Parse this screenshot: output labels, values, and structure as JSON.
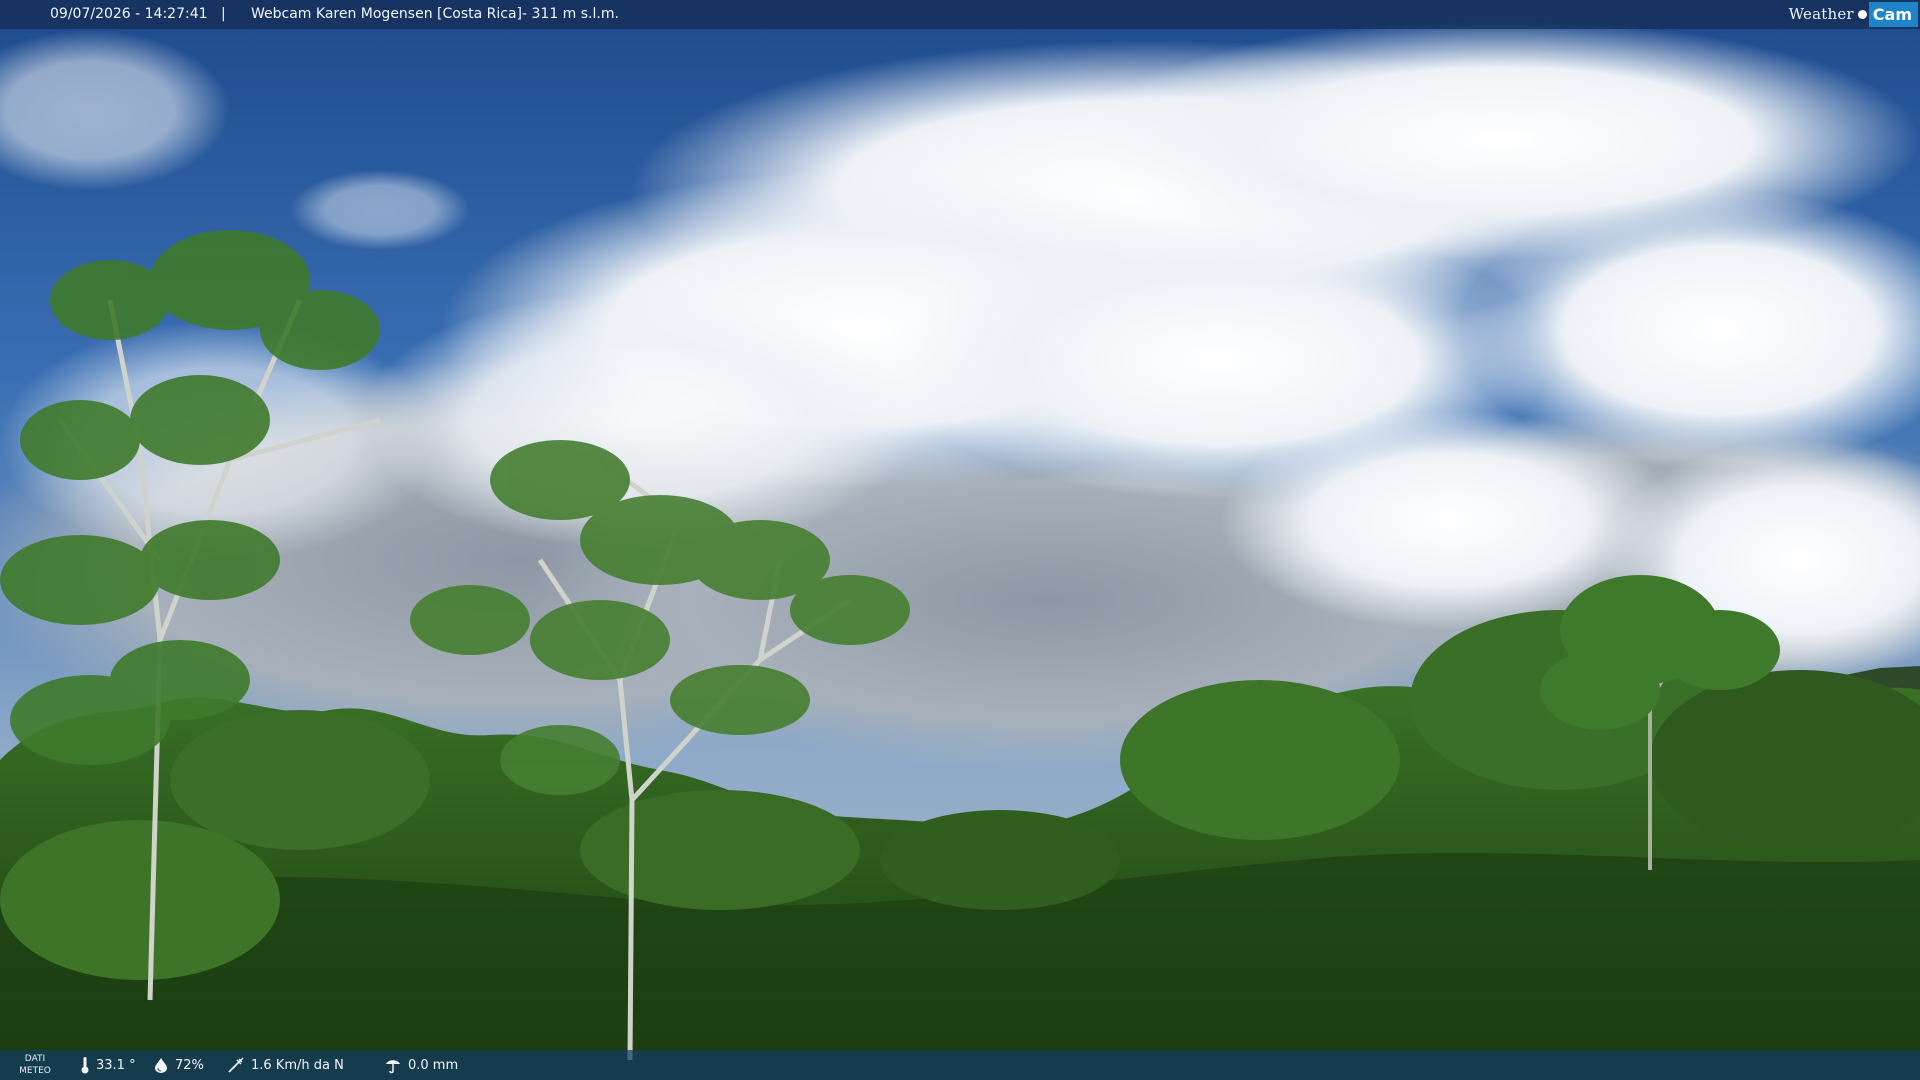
{
  "overlay": {
    "datetime": "09/07/2026 - 14:27:41",
    "separator": "|",
    "title": "Webcam Karen Mogensen [Costa Rica]",
    "altitude": "- 311 m s.l.m.",
    "logo": {
      "word": "Weather",
      "badge": "Cam"
    }
  },
  "weather": {
    "label_line1": "DATI",
    "label_line2": "METEO",
    "temperature": "33.1 °",
    "humidity": "72%",
    "wind": "1.6 Km/h da N",
    "rain": "0.0 mm"
  },
  "icons": {
    "temperature": "thermometer-icon",
    "humidity": "humidity-drop-icon",
    "wind": "wind-icon",
    "rain": "rain-gauge-icon"
  },
  "colors": {
    "sky": "#2a5da6",
    "cloud": "#e9eef4",
    "forest": "#2f5a1f",
    "overlay_bar": "#142d55",
    "logo_badge": "#1e86c8"
  }
}
